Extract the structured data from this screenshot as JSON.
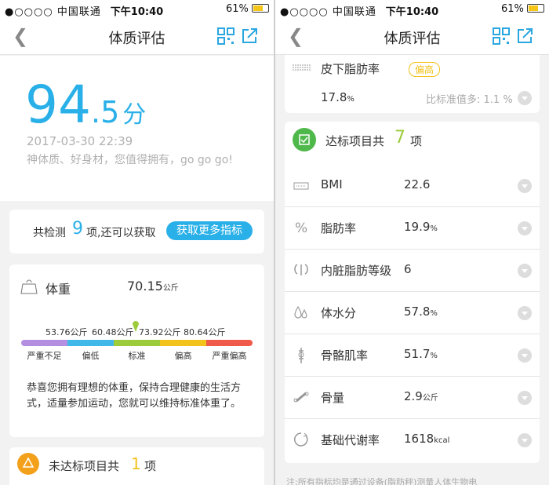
{
  "status": {
    "carrier": "●○○○○ 中国联通",
    "time": "下午10:40",
    "battery": "61%"
  },
  "nav": {
    "title": "体质评估"
  },
  "score": {
    "integer": "94",
    "decimal": ".5",
    "unit": "分",
    "date": "2017-03-30 22:39",
    "comment": "神体质、好身材，您值得拥有，go go go!"
  },
  "detect": {
    "prefix": "共检测",
    "count": "9",
    "suffix": "项,还可以获取",
    "button": "获取更多指标"
  },
  "weight": {
    "label": "体重",
    "value": "70.15",
    "unit": "公斤",
    "thresholds": [
      "53.76公斤",
      "60.48公斤",
      "73.92公斤",
      "80.64公斤"
    ],
    "segments": [
      {
        "label": "严重不足",
        "color": "#b48ee0"
      },
      {
        "label": "偏低",
        "color": "#41b9e8"
      },
      {
        "label": "标准",
        "color": "#9ccc3c"
      },
      {
        "label": "偏高",
        "color": "#f3c21b"
      },
      {
        "label": "严重偏高",
        "color": "#ef5a4a"
      }
    ],
    "advice": "恭喜您拥有理想的体重，保持合理健康的生活方式，适量参加运动，您就可以维持标准体重了。"
  },
  "unmet": {
    "prefix": "未达标项目共",
    "count": "1",
    "suffix": "项"
  },
  "fat": {
    "label": "皮下脂肪率",
    "badge": "偏高",
    "value": "17.8",
    "unit": "%",
    "note": "比标准值多: 1.1 %"
  },
  "met": {
    "prefix": "达标项目共",
    "count": "7",
    "suffix": "项"
  },
  "metrics": [
    {
      "name": "BMI",
      "value": "22.6",
      "unit": "",
      "icon": "scale-icon"
    },
    {
      "name": "脂肪率",
      "value": "19.9",
      "unit": "%",
      "icon": "percent-icon"
    },
    {
      "name": "内脏脂肪等级",
      "value": "6",
      "unit": "",
      "icon": "organ-icon"
    },
    {
      "name": "体水分",
      "value": "57.8",
      "unit": "%",
      "icon": "water-drop-icon"
    },
    {
      "name": "骨骼肌率",
      "value": "51.7",
      "unit": "%",
      "icon": "muscle-icon"
    },
    {
      "name": "骨量",
      "value": "2.9",
      "unit": "公斤",
      "icon": "bone-icon"
    },
    {
      "name": "基础代谢率",
      "value": "1618",
      "unit": "kcal",
      "icon": "metabolism-icon"
    }
  ],
  "footnote": "注:所有指标均是通过设备(脂肪秤)测量人体生物电"
}
